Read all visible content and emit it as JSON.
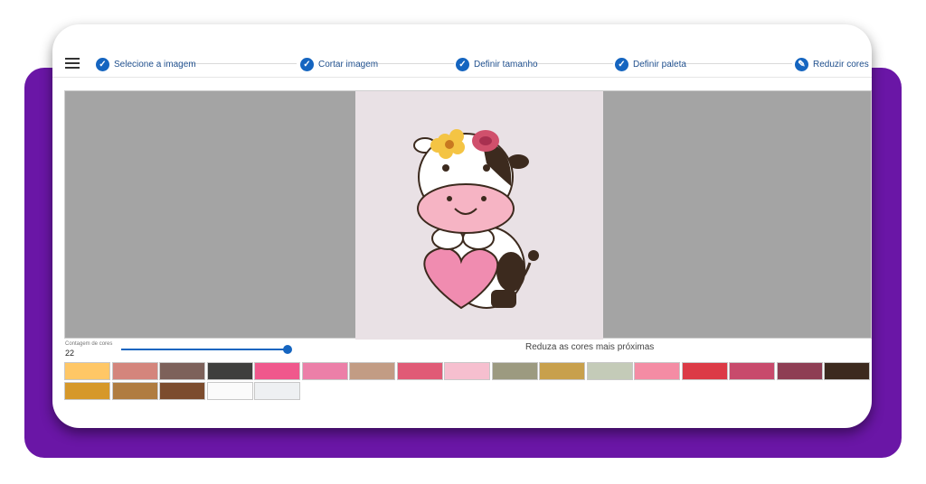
{
  "stepper": {
    "menu_icon": "hamburger-menu-icon",
    "steps": [
      {
        "label": "Selecione a imagem",
        "icon": "check-icon"
      },
      {
        "label": "Cortar imagem",
        "icon": "check-icon"
      },
      {
        "label": "Definir tamanho",
        "icon": "check-icon"
      },
      {
        "label": "Definir paleta",
        "icon": "check-icon"
      },
      {
        "label": "Reduzir cores",
        "icon": "pencil-icon"
      }
    ]
  },
  "controls": {
    "slider_label": "Contagem de cores",
    "slider_value": "22",
    "reduce_button_label": "Reduza as cores mais próximas"
  },
  "palette": [
    "#ffc766",
    "#d4857c",
    "#7d615a",
    "#3f3f3d",
    "#f0588c",
    "#ec7fa8",
    "#c29c84",
    "#e05a76",
    "#f6bfcf",
    "#9c9a80",
    "#c8a04c",
    "#c4cbb8",
    "#f48ca4",
    "#dc3a46",
    "#c84a6c",
    "#8e3e54",
    "#3c2a1e",
    "#d6982a",
    "#b07c40",
    "#7c4c2e",
    "#fbfbfb",
    "#eef0f2"
  ],
  "colors": {
    "accent": "#1565c0",
    "purple": "#6a16a6",
    "canvas_bg": "#a4a4a4",
    "image_bg": "#e9e1e5"
  }
}
